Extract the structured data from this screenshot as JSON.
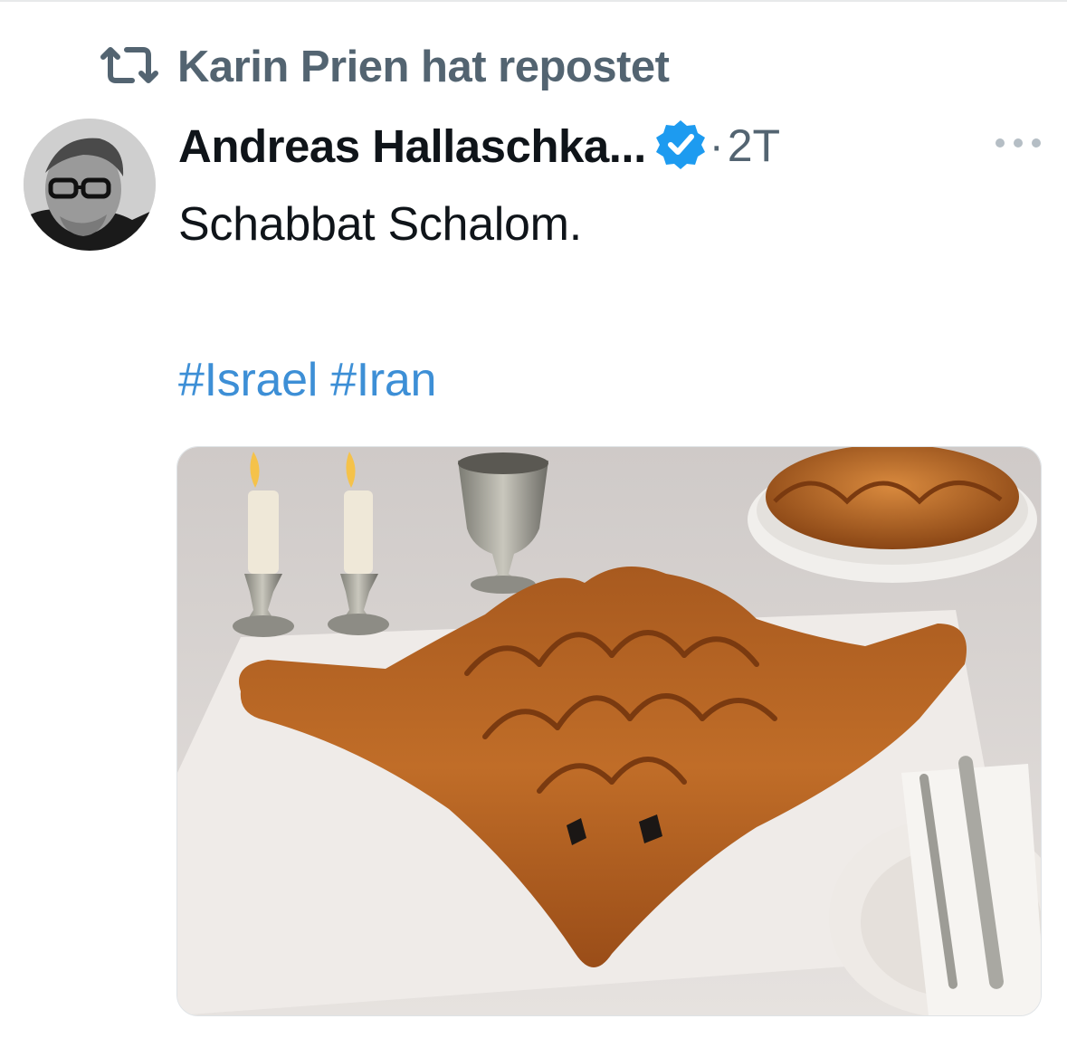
{
  "repost": {
    "icon": "repost-icon",
    "text": "Karin Prien hat repostet"
  },
  "tweet": {
    "author_name": "Andreas Hallaschka...",
    "separator": "·",
    "time": "2T",
    "text": "Schabbat Schalom.",
    "hashtags": [
      "#Israel",
      "#Iran"
    ],
    "verified_color": "#1d9bf0",
    "link_color": "#3d8fd6"
  }
}
